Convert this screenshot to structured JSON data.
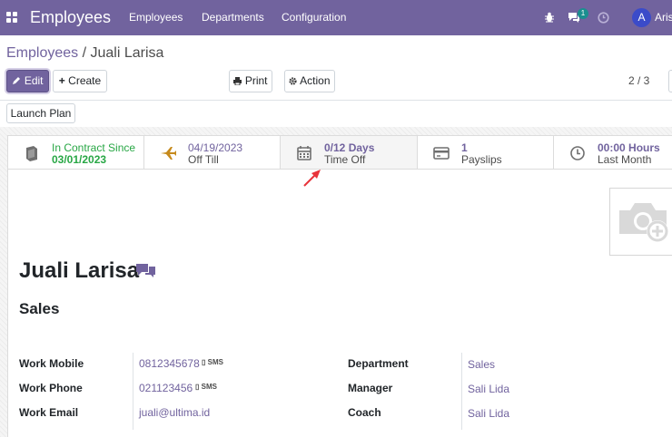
{
  "navbar": {
    "brand": "Employees",
    "menu": [
      "Employees",
      "Departments",
      "Configuration"
    ],
    "messages_badge": "1",
    "user_initial": "A",
    "user_name": "Aris"
  },
  "breadcrumb": {
    "parent": "Employees",
    "separator": " / ",
    "current": "Juali Larisa"
  },
  "toolbar": {
    "edit_label": "Edit",
    "create_label": "Create",
    "print_label": "Print",
    "action_label": "Action",
    "pager": "2 / 3",
    "launch_plan_label": "Launch Plan"
  },
  "smart_buttons": [
    {
      "value": "In Contract Since",
      "label": "03/01/2023",
      "icon": "book-icon"
    },
    {
      "value": "04/19/2023",
      "label": "Off Till",
      "icon": "plane-icon"
    },
    {
      "value": "0/12 Days",
      "label": "Time Off",
      "icon": "calendar-icon"
    },
    {
      "value": "1",
      "label": "Payslips",
      "icon": "credit-card-icon"
    },
    {
      "value": "00:00 Hours",
      "label": "Last Month",
      "icon": "clock-icon"
    }
  ],
  "employee": {
    "name": "Juali Larisa",
    "job_title": "Sales"
  },
  "fields_left": [
    {
      "label": "Work Mobile",
      "value": "0812345678",
      "sms": "SMS"
    },
    {
      "label": "Work Phone",
      "value": "021123456",
      "sms": "SMS"
    },
    {
      "label": "Work Email",
      "value": "juali@ultima.id"
    }
  ],
  "fields_right": [
    {
      "label": "Department",
      "value": "Sales"
    },
    {
      "label": "Manager",
      "value": "Sali Lida"
    },
    {
      "label": "Coach",
      "value": "Sali Lida"
    }
  ],
  "colors": {
    "brand": "#71639e",
    "contract_green": "#28a745",
    "annotation_arrow": "#e8343b"
  }
}
